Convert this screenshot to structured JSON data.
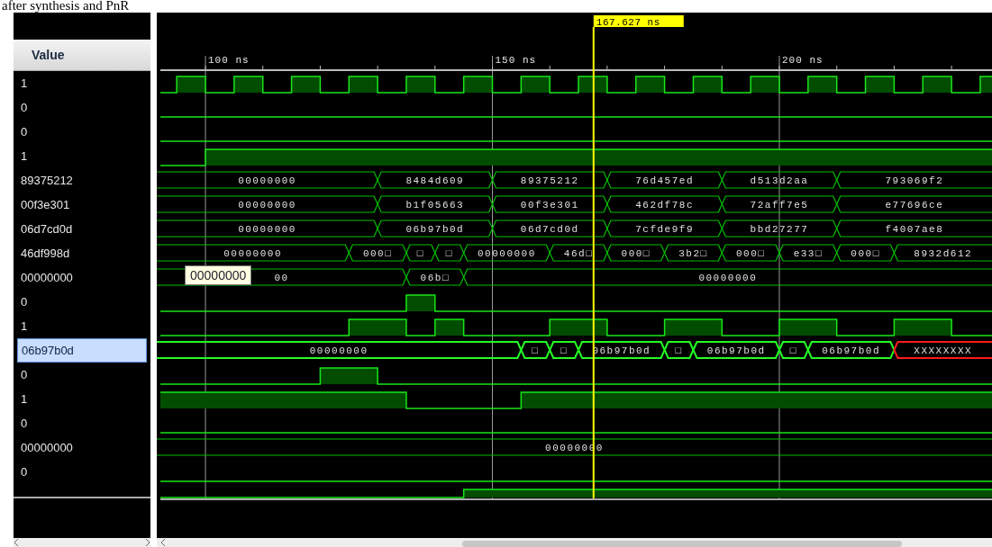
{
  "caption": "after synthesis and PnR",
  "value_header": "Value",
  "time_axis": {
    "labels": [
      "100 ns",
      "150 ns",
      "200 ns"
    ]
  },
  "cursor": {
    "label": "167.627 ns"
  },
  "tooltip": {
    "text": "00000000"
  },
  "signals": [
    {
      "value": "1",
      "selected": false,
      "kind": "clock"
    },
    {
      "value": "0",
      "selected": false,
      "kind": "bit"
    },
    {
      "value": "0",
      "selected": false,
      "kind": "bit"
    },
    {
      "value": "1",
      "selected": false,
      "kind": "bit"
    },
    {
      "value": "89375212",
      "selected": false,
      "kind": "bus",
      "segments": [
        {
          "text": "00000000"
        },
        {
          "text": "8484d609"
        },
        {
          "text": "89375212"
        },
        {
          "text": "76d457ed"
        },
        {
          "text": "d513d2aa"
        },
        {
          "text": "793069f2"
        }
      ]
    },
    {
      "value": "00f3e301",
      "selected": false,
      "kind": "bus",
      "segments": [
        {
          "text": "00000000"
        },
        {
          "text": "b1f05663"
        },
        {
          "text": "00f3e301"
        },
        {
          "text": "462df78c"
        },
        {
          "text": "72aff7e5"
        },
        {
          "text": "e77696ce"
        }
      ]
    },
    {
      "value": "06d7cd0d",
      "selected": false,
      "kind": "bus",
      "segments": [
        {
          "text": "00000000"
        },
        {
          "text": "06b97b0d"
        },
        {
          "text": "06d7cd0d"
        },
        {
          "text": "7cfde9f9"
        },
        {
          "text": "bbd27277"
        },
        {
          "text": "f4007ae8"
        }
      ]
    },
    {
      "value": "46df998d",
      "selected": false,
      "kind": "bus",
      "segments": [
        {
          "text": "00000000"
        },
        {
          "text": "000□"
        },
        {
          "text": "□"
        },
        {
          "text": "□"
        },
        {
          "text": "00000000"
        },
        {
          "text": "46d□"
        },
        {
          "text": "000□"
        },
        {
          "text": "3b2□"
        },
        {
          "text": "000□"
        },
        {
          "text": "e33□"
        },
        {
          "text": "000□"
        },
        {
          "text": "8932d612"
        }
      ]
    },
    {
      "value": "00000000",
      "selected": false,
      "kind": "bus",
      "segments": [
        {
          "text": "00"
        },
        {
          "text": "06b□"
        },
        {
          "text": "00000000"
        }
      ]
    },
    {
      "value": "0",
      "selected": false,
      "kind": "bit"
    },
    {
      "value": "1",
      "selected": false,
      "kind": "bit"
    },
    {
      "value": "06b97b0d",
      "selected": true,
      "kind": "bus",
      "segments": [
        {
          "text": "00000000",
          "kind": "value"
        },
        {
          "text": "□",
          "kind": "value"
        },
        {
          "text": "□",
          "kind": "value"
        },
        {
          "text": "06b97b0d",
          "kind": "value"
        },
        {
          "text": "□",
          "kind": "value"
        },
        {
          "text": "06b97b0d",
          "kind": "value"
        },
        {
          "text": "□",
          "kind": "value"
        },
        {
          "text": "06b97b0d",
          "kind": "value"
        },
        {
          "text": "XXXXXXXX",
          "kind": "unknown"
        }
      ]
    },
    {
      "value": "0",
      "selected": false,
      "kind": "bit"
    },
    {
      "value": "1",
      "selected": false,
      "kind": "bit"
    },
    {
      "value": "0",
      "selected": false,
      "kind": "bit"
    },
    {
      "value": "00000000",
      "selected": false,
      "kind": "bus",
      "segments": [
        {
          "text": "00000000"
        }
      ]
    },
    {
      "value": "0",
      "selected": false,
      "kind": "bit"
    },
    {
      "selected": false,
      "kind": "bit"
    }
  ]
}
